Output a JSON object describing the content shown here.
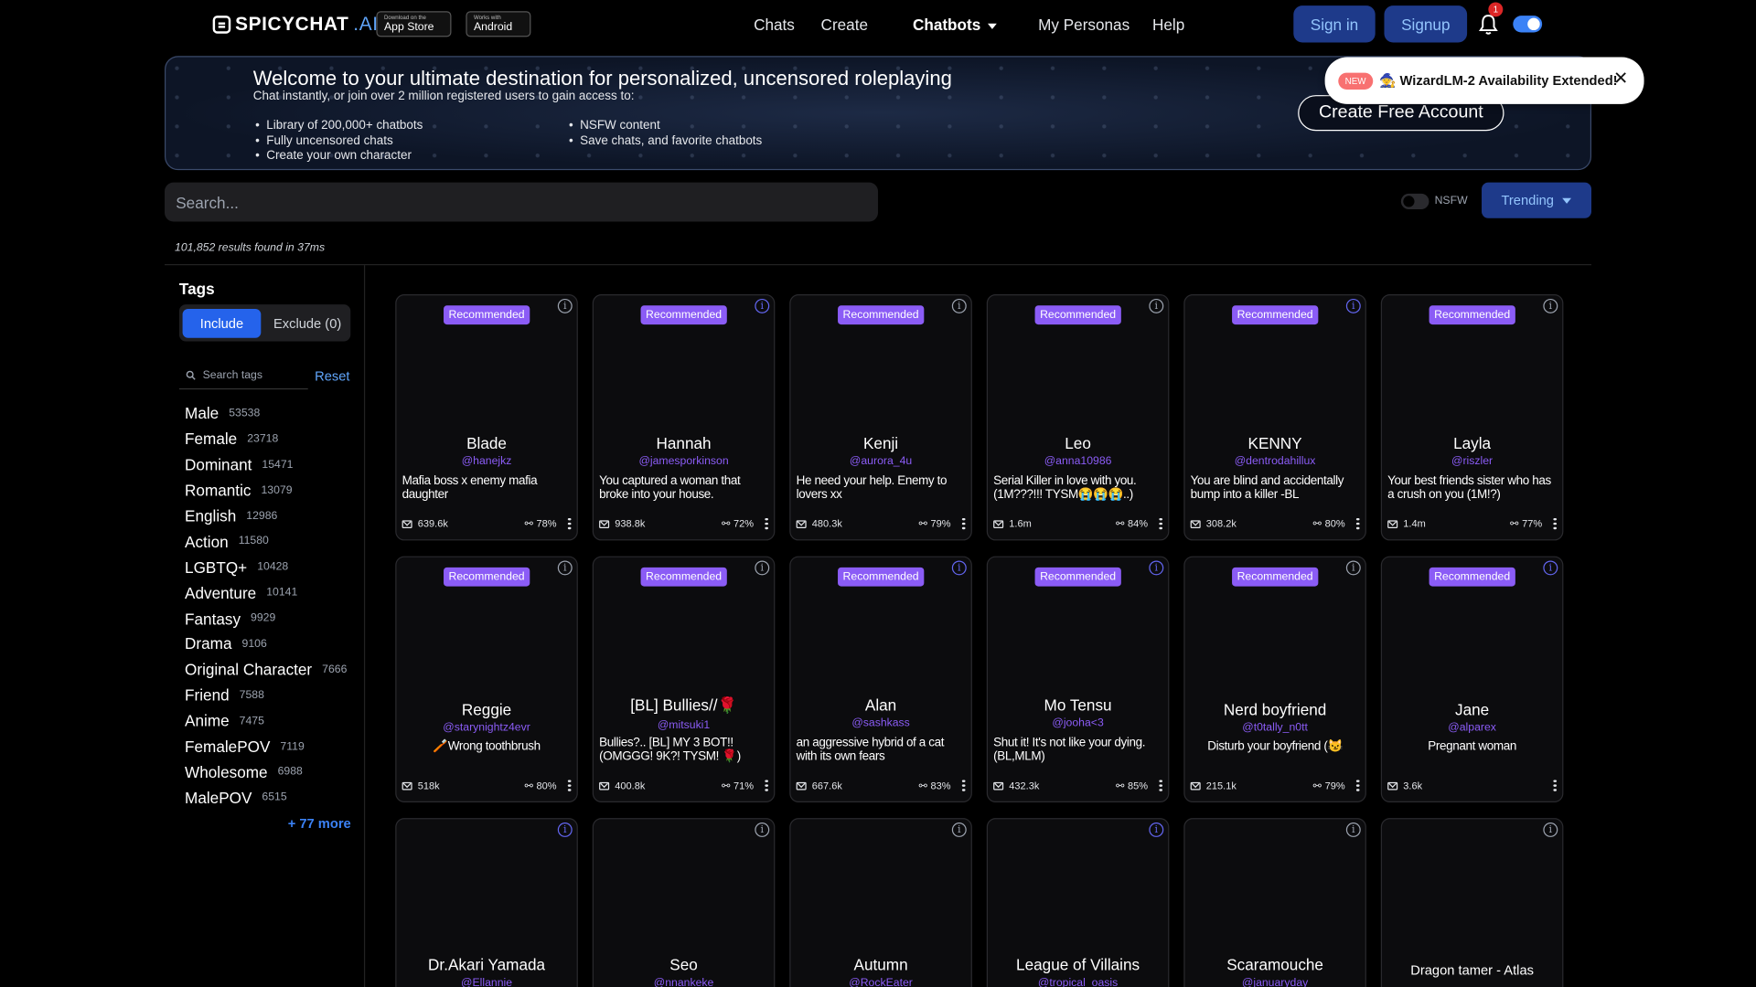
{
  "header": {
    "logo_main": "SPICYCHAT",
    "logo_suffix": ".AI",
    "appstore_small": "Download on the",
    "appstore_big": "App Store",
    "android_small": "Works with",
    "android_big": "Android",
    "nav": [
      "Chats",
      "Create",
      "Chatbots",
      "My Personas",
      "Help"
    ],
    "signin": "Sign in",
    "signup": "Signup",
    "notif_count": "1"
  },
  "banner": {
    "title": "Welcome to your ultimate destination for personalized, uncensored roleplaying",
    "subtitle": "Chat instantly, or join over 2 million registered users to gain access to:",
    "list_left": [
      "Library of 200,000+ chatbots",
      "Fully uncensored chats",
      "Create your own character"
    ],
    "list_right": [
      "NSFW content",
      "Save chats, and favorite chatbots"
    ],
    "cta": "Create Free Account"
  },
  "toast": {
    "badge": "NEW",
    "message": "🧙 WizardLM-2 Availability Extended!",
    "close": "✕"
  },
  "search": {
    "placeholder": "Search...",
    "nsfw_label": "NSFW",
    "sort": "Trending"
  },
  "results_text": "101,852 results found in 37ms",
  "sidebar": {
    "title": "Tags",
    "include": "Include",
    "exclude": "Exclude (0)",
    "search_placeholder": "Search tags",
    "reset": "Reset",
    "tags": [
      {
        "name": "Male",
        "count": "53538"
      },
      {
        "name": "Female",
        "count": "23718"
      },
      {
        "name": "Dominant",
        "count": "15471"
      },
      {
        "name": "Romantic",
        "count": "13079"
      },
      {
        "name": "English",
        "count": "12986"
      },
      {
        "name": "Action",
        "count": "11580"
      },
      {
        "name": "LGBTQ+",
        "count": "10428"
      },
      {
        "name": "Adventure",
        "count": "10141"
      },
      {
        "name": "Fantasy",
        "count": "9929"
      },
      {
        "name": "Drama",
        "count": "9106"
      },
      {
        "name": "Original Character",
        "count": "7666"
      },
      {
        "name": "Friend",
        "count": "7588"
      },
      {
        "name": "Anime",
        "count": "7475"
      },
      {
        "name": "FemalePOV",
        "count": "7119"
      },
      {
        "name": "Wholesome",
        "count": "6988"
      },
      {
        "name": "MalePOV",
        "count": "6515"
      }
    ],
    "more": "+ 77 more"
  },
  "badge_label": "Recommended",
  "cards_row1": [
    {
      "name": "Blade",
      "handle": "@hanejkz",
      "desc": "Mafia boss x enemy mafia daughter",
      "msgs": "639.6k",
      "rating": "78%"
    },
    {
      "name": "Hannah",
      "handle": "@jamesporkinson",
      "desc": "You captured a woman that broke into your house.",
      "msgs": "938.8k",
      "rating": "72%"
    },
    {
      "name": "Kenji",
      "handle": "@aurora_4u",
      "desc": "He need your help. Enemy to lovers xx",
      "msgs": "480.3k",
      "rating": "79%"
    },
    {
      "name": "Leo",
      "handle": "@anna10986",
      "desc": "Serial Killer in love with you. (1M???!!! TYSM😭😭😭..)",
      "msgs": "1.6m",
      "rating": "84%"
    },
    {
      "name": "KENNY",
      "handle": "@dentrodahillux",
      "desc": "You are blind and accidentally bump into a killer -BL",
      "msgs": "308.2k",
      "rating": "80%"
    },
    {
      "name": "Layla",
      "handle": "@riszler",
      "desc": "Your best friends sister who has a crush on you (1M!?)",
      "msgs": "1.4m",
      "rating": "77%"
    }
  ],
  "cards_row2": [
    {
      "name": "Reggie",
      "handle": "@starynightz4evr",
      "desc": "🪥Wrong toothbrush",
      "msgs": "518k",
      "rating": "80%"
    },
    {
      "name": "[BL] Bullies//🌹",
      "handle": "@mitsuki1",
      "desc": "Bullies?.. [BL] MY 3 BOT!! (OMGGG! 9K?! TYSM! 🌹)",
      "msgs": "400.8k",
      "rating": "71%"
    },
    {
      "name": "Alan",
      "handle": "@sashkass",
      "desc": "an aggressive hybrid of a cat with its own fears",
      "msgs": "667.6k",
      "rating": "83%"
    },
    {
      "name": "Mo Tensu",
      "handle": "@jooha<3",
      "desc": "Shut it! It's not like your dying. (BL,MLM)",
      "msgs": "432.3k",
      "rating": "85%"
    },
    {
      "name": "Nerd boyfriend",
      "handle": "@t0tally_n0tt",
      "desc": "Disturb your boyfriend (😼",
      "msgs": "215.1k",
      "rating": "79%"
    },
    {
      "name": "Jane",
      "handle": "@alparex",
      "desc": "Pregnant woman",
      "msgs": "3.6k",
      "rating": ""
    }
  ],
  "cards_row3": [
    {
      "name": "Dr.Akari Yamada",
      "handle": "@Ellannie"
    },
    {
      "name": "Seo",
      "handle": "@nnankeke"
    },
    {
      "name": "Autumn",
      "handle": "@RockEater"
    },
    {
      "name": "League of Villains",
      "handle": "@tropical_oasis"
    },
    {
      "name": "Scaramouche",
      "handle": "@januaryday"
    },
    {
      "name": "Dragon tamer - Atlas",
      "handle": ""
    }
  ]
}
